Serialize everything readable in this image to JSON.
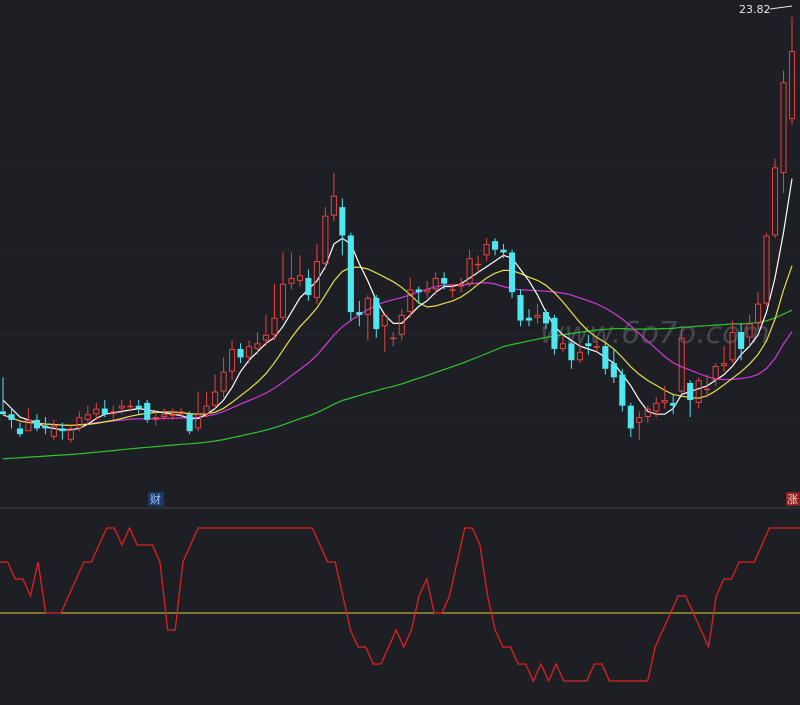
{
  "price_label": "23.82",
  "markers": {
    "finance": "财",
    "limit_up": "涨"
  },
  "watermark": "www.6o7o.com",
  "colors": {
    "background": "#1d1f25",
    "grid": "#3a3d46",
    "candle_up": "#e8433e",
    "candle_down": "#50e6f0",
    "ma5": "#ffffff",
    "ma10": "#e8e04a",
    "ma20": "#d13ad6",
    "ma60": "#2fc52f",
    "indicator": "#e02020",
    "indicator_level": "#e8c63a",
    "finance_marker_bg": "#1c3a66",
    "limitup_marker_bg": "#8a1f1f"
  },
  "chart_data": [
    {
      "type": "candlestick",
      "title": "",
      "price_scale_label": "23.82",
      "y_range": [
        6.6,
        24.4
      ],
      "candles": [
        [
          9.9,
          9.8,
          11.1,
          9.8
        ],
        [
          9.8,
          9.6,
          10.0,
          9.3
        ],
        [
          9.3,
          9.1,
          9.5,
          9.0
        ],
        [
          9.2,
          9.6,
          10.0,
          9.2
        ],
        [
          9.6,
          9.3,
          9.8,
          9.2
        ],
        [
          9.4,
          9.3,
          9.7,
          9.1
        ],
        [
          9.0,
          9.4,
          9.6,
          8.9
        ],
        [
          9.3,
          9.2,
          9.5,
          8.9
        ],
        [
          8.9,
          9.3,
          9.4,
          8.8
        ],
        [
          9.3,
          9.7,
          9.9,
          9.2
        ],
        [
          9.6,
          9.8,
          10.1,
          9.4
        ],
        [
          9.8,
          10.0,
          10.2,
          9.6
        ],
        [
          10.0,
          9.8,
          10.3,
          9.7
        ],
        [
          9.8,
          9.9,
          10.1,
          9.6
        ],
        [
          10.0,
          10.1,
          10.3,
          9.8
        ],
        [
          10.1,
          10.1,
          10.3,
          9.9
        ],
        [
          10.1,
          10.0,
          10.3,
          9.8
        ],
        [
          10.2,
          9.6,
          10.3,
          9.5
        ],
        [
          9.6,
          9.7,
          9.9,
          9.4
        ],
        [
          9.7,
          9.8,
          10.0,
          9.6
        ],
        [
          9.8,
          9.8,
          10.0,
          9.6
        ],
        [
          9.8,
          9.9,
          10.0,
          9.7
        ],
        [
          9.8,
          9.2,
          9.9,
          9.1
        ],
        [
          9.3,
          9.8,
          10.6,
          9.2
        ],
        [
          9.8,
          10.1,
          10.6,
          9.7
        ],
        [
          10.1,
          10.6,
          11.2,
          10.0
        ],
        [
          10.6,
          11.3,
          11.8,
          10.4
        ],
        [
          11.3,
          12.1,
          12.4,
          11.0
        ],
        [
          12.1,
          11.8,
          12.3,
          11.6
        ],
        [
          11.8,
          12.2,
          12.4,
          11.6
        ],
        [
          12.1,
          12.3,
          12.7,
          11.9
        ],
        [
          12.4,
          12.6,
          13.3,
          12.2
        ],
        [
          12.6,
          13.2,
          14.4,
          12.4
        ],
        [
          13.2,
          14.4,
          15.5,
          13.1
        ],
        [
          14.4,
          14.6,
          15.5,
          14.2
        ],
        [
          14.5,
          14.7,
          15.4,
          14.3
        ],
        [
          14.6,
          14.0,
          14.9,
          13.8
        ],
        [
          13.9,
          15.2,
          15.8,
          13.7
        ],
        [
          15.1,
          16.8,
          17.1,
          14.9
        ],
        [
          16.8,
          17.5,
          18.3,
          16.6
        ],
        [
          17.1,
          16.1,
          17.4,
          15.4
        ],
        [
          16.1,
          13.4,
          16.2,
          13.1
        ],
        [
          13.4,
          13.3,
          13.8,
          12.9
        ],
        [
          13.3,
          13.9,
          14.0,
          12.4
        ],
        [
          13.9,
          12.8,
          14.0,
          12.5
        ],
        [
          12.9,
          13.3,
          13.3,
          12.0
        ],
        [
          12.5,
          12.5,
          12.7,
          12.2
        ],
        [
          12.6,
          13.3,
          13.5,
          12.4
        ],
        [
          13.4,
          14.2,
          14.6,
          13.2
        ],
        [
          14.2,
          14.1,
          14.3,
          13.7
        ],
        [
          14.1,
          14.2,
          14.5,
          13.9
        ],
        [
          14.2,
          14.6,
          14.8,
          14.0
        ],
        [
          14.6,
          14.4,
          14.8,
          14.2
        ],
        [
          14.2,
          14.2,
          14.4,
          13.9
        ],
        [
          14.3,
          14.4,
          14.6,
          14.1
        ],
        [
          14.4,
          15.3,
          15.6,
          14.3
        ],
        [
          15.1,
          15.1,
          15.4,
          14.8
        ],
        [
          15.4,
          15.8,
          16.0,
          15.2
        ],
        [
          15.9,
          15.6,
          16.0,
          15.4
        ],
        [
          15.6,
          15.5,
          15.8,
          15.3
        ],
        [
          15.5,
          14.1,
          15.6,
          13.9
        ],
        [
          14.0,
          13.1,
          14.2,
          12.9
        ],
        [
          13.2,
          13.1,
          13.5,
          12.9
        ],
        [
          13.2,
          13.3,
          13.7,
          13.0
        ],
        [
          13.4,
          13.0,
          13.5,
          12.8
        ],
        [
          13.2,
          12.1,
          13.3,
          11.9
        ],
        [
          12.1,
          12.3,
          12.6,
          12.0
        ],
        [
          12.3,
          11.7,
          12.4,
          11.4
        ],
        [
          11.7,
          12.0,
          12.3,
          11.6
        ],
        [
          12.3,
          12.2,
          12.6,
          11.9
        ],
        [
          12.2,
          12.2,
          12.4,
          12.0
        ],
        [
          12.2,
          11.4,
          12.3,
          11.2
        ],
        [
          11.6,
          11.1,
          12.1,
          10.9
        ],
        [
          11.2,
          10.1,
          11.4,
          9.9
        ],
        [
          10.1,
          9.3,
          10.2,
          9.0
        ],
        [
          9.5,
          9.7,
          9.9,
          8.9
        ],
        [
          9.7,
          10.0,
          10.1,
          9.5
        ],
        [
          9.9,
          10.2,
          10.4,
          9.7
        ],
        [
          10.2,
          10.3,
          10.8,
          10.0
        ],
        [
          10.2,
          10.1,
          10.5,
          9.8
        ],
        [
          10.6,
          12.5,
          12.9,
          10.5
        ],
        [
          10.9,
          10.3,
          11.0,
          9.7
        ],
        [
          10.2,
          11.0,
          11.1,
          10.0
        ],
        [
          10.7,
          10.7,
          11.2,
          10.4
        ],
        [
          11.0,
          11.5,
          11.6,
          10.8
        ],
        [
          11.5,
          11.6,
          12.2,
          11.3
        ],
        [
          11.7,
          12.7,
          13.1,
          11.6
        ],
        [
          12.7,
          12.1,
          13.0,
          11.7
        ],
        [
          12.5,
          13.0,
          13.3,
          12.2
        ],
        [
          13.0,
          13.7,
          14.1,
          12.8
        ],
        [
          13.7,
          16.1,
          16.2,
          13.6
        ],
        [
          16.1,
          18.5,
          18.8,
          16.0
        ],
        [
          18.3,
          21.5,
          21.9,
          17.6
        ],
        [
          20.2,
          22.6,
          23.8,
          20.0
        ]
      ],
      "ma5": [
        10.3,
        10.0,
        9.7,
        9.6,
        9.5,
        9.35,
        9.3,
        9.25,
        9.25,
        9.3,
        9.45,
        9.65,
        9.8,
        9.85,
        9.9,
        9.95,
        10.0,
        9.95,
        9.9,
        9.85,
        9.8,
        9.75,
        9.65,
        9.65,
        9.8,
        10.0,
        10.3,
        10.75,
        11.3,
        11.7,
        12.0,
        12.3,
        12.5,
        12.9,
        13.4,
        13.9,
        14.2,
        14.5,
        15.0,
        15.8,
        16.0,
        15.8,
        15.1,
        14.5,
        13.8,
        13.3,
        13.0,
        13.0,
        13.3,
        13.6,
        13.8,
        14.1,
        14.3,
        14.3,
        14.4,
        14.6,
        14.8,
        15.0,
        15.2,
        15.4,
        15.3,
        14.9,
        14.5,
        14.0,
        13.4,
        12.9,
        12.6,
        12.4,
        12.2,
        12.1,
        12.0,
        11.8,
        11.6,
        11.2,
        10.8,
        10.3,
        9.9,
        9.8,
        9.8,
        10.0,
        10.5,
        10.6,
        10.7,
        10.8,
        11.0,
        11.2,
        11.5,
        11.9,
        12.2,
        12.6,
        13.4,
        14.6,
        16.2,
        18.1
      ]
    },
    {
      "type": "line",
      "title": "",
      "y_range": [
        0,
        100
      ],
      "level": 50,
      "values": [
        80,
        80,
        70,
        70,
        60,
        80,
        50,
        50,
        50,
        60,
        70,
        80,
        80,
        90,
        100,
        100,
        90,
        100,
        90,
        90,
        90,
        80,
        40,
        40,
        80,
        90,
        100,
        100,
        100,
        100,
        100,
        100,
        100,
        100,
        100,
        100,
        100,
        100,
        100,
        100,
        100,
        100,
        90,
        80,
        80,
        60,
        40,
        30,
        30,
        20,
        20,
        30,
        40,
        30,
        40,
        60,
        70,
        50,
        50,
        60,
        80,
        100,
        100,
        90,
        60,
        40,
        30,
        30,
        20,
        20,
        10,
        20,
        10,
        20,
        10,
        10,
        10,
        10,
        20,
        20,
        10,
        10,
        10,
        10,
        10,
        10,
        30,
        40,
        50,
        60,
        60,
        50,
        40,
        30,
        60,
        70,
        70,
        80,
        80,
        80,
        90,
        100,
        100,
        100,
        100,
        100
      ]
    }
  ]
}
